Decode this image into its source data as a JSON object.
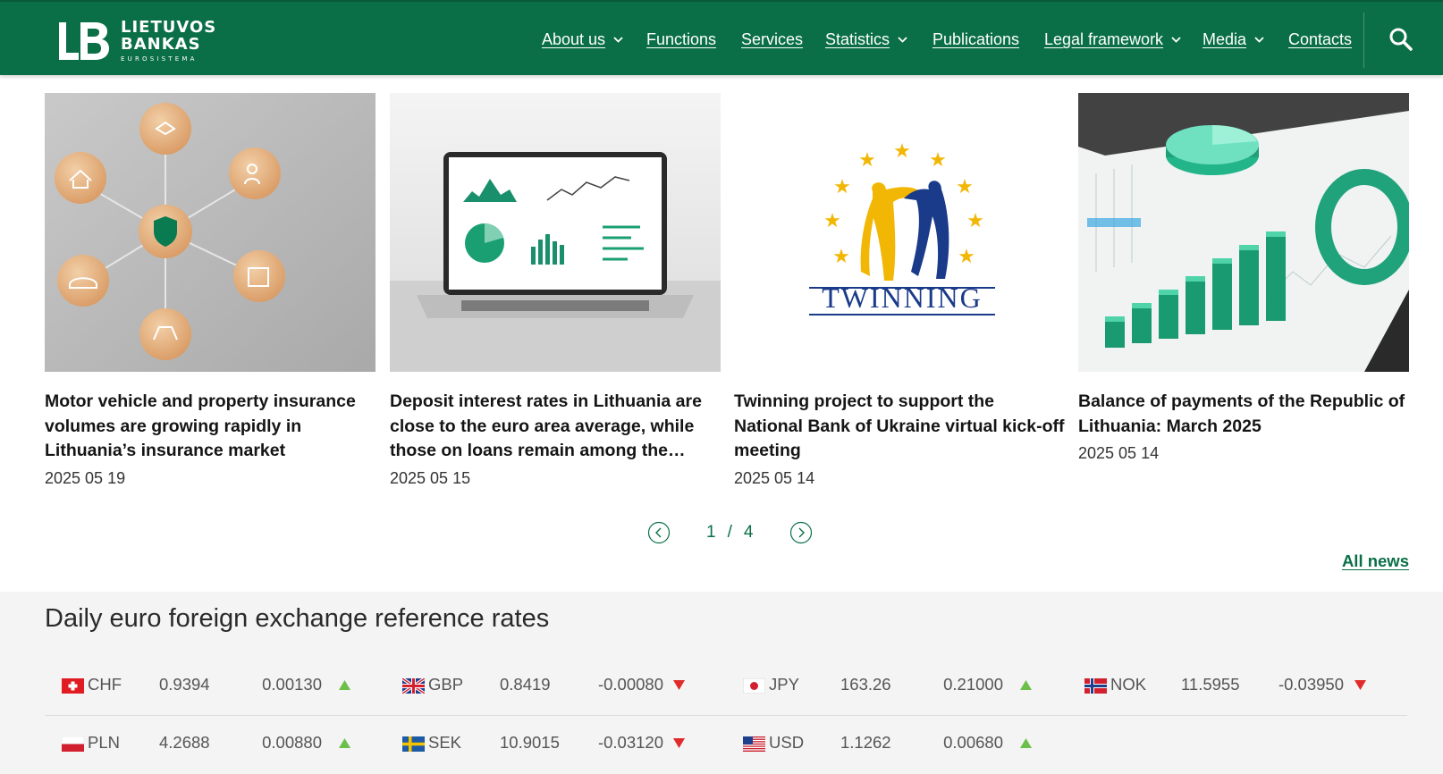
{
  "header": {
    "logo": {
      "line1": "LIETUVOS",
      "line2": "BANKAS",
      "sub": "EUROSISTEMA"
    },
    "nav": [
      {
        "label": "About us",
        "has_dropdown": true
      },
      {
        "label": "Functions",
        "has_dropdown": false
      },
      {
        "label": "Services",
        "has_dropdown": false
      },
      {
        "label": "Statistics",
        "has_dropdown": true
      },
      {
        "label": "Publications",
        "has_dropdown": false
      },
      {
        "label": "Legal framework",
        "has_dropdown": true
      },
      {
        "label": "Media",
        "has_dropdown": true
      },
      {
        "label": "Contacts",
        "has_dropdown": false
      }
    ],
    "search_icon": "search-icon"
  },
  "news": [
    {
      "title": "Motor vehicle and property insurance volumes are growing rapidly in Lithuania’s insurance market",
      "date": "2025 05 19"
    },
    {
      "title": "Deposit interest rates in Lithuania are close to the euro area average, while those on loans remain among the…",
      "date": "2025 05 15"
    },
    {
      "title": "Twinning project to support the National Bank of Ukraine virtual kick-off meeting",
      "date": "2025 05 14"
    },
    {
      "title": "Balance of payments of the Republic of Lithuania: March 2025",
      "date": "2025 05 14"
    }
  ],
  "twinning_logo_text": "TWINNING",
  "pager": {
    "current": "1",
    "separator": "/",
    "total": "4"
  },
  "all_news": "All news",
  "rates": {
    "title": "Daily euro foreign exchange reference rates",
    "items": [
      {
        "code": "CHF",
        "value": "0.9394",
        "change": "0.00130",
        "direction": "up",
        "flag": "flag-ch-icon"
      },
      {
        "code": "GBP",
        "value": "0.8419",
        "change": "-0.00080",
        "direction": "down",
        "flag": "flag-gb-icon"
      },
      {
        "code": "JPY",
        "value": "163.26",
        "change": "0.21000",
        "direction": "up",
        "flag": "flag-jp-icon"
      },
      {
        "code": "NOK",
        "value": "11.5955",
        "change": "-0.03950",
        "direction": "down",
        "flag": "flag-no-icon"
      },
      {
        "code": "PLN",
        "value": "4.2688",
        "change": "0.00880",
        "direction": "up",
        "flag": "flag-pl-icon"
      },
      {
        "code": "SEK",
        "value": "10.9015",
        "change": "-0.03120",
        "direction": "down",
        "flag": "flag-se-icon"
      },
      {
        "code": "USD",
        "value": "1.1262",
        "change": "0.00680",
        "direction": "up",
        "flag": "flag-us-icon"
      }
    ]
  },
  "colors": {
    "brand_green": "#0a6f47",
    "up": "#6cc04a",
    "down": "#e02b2b"
  }
}
